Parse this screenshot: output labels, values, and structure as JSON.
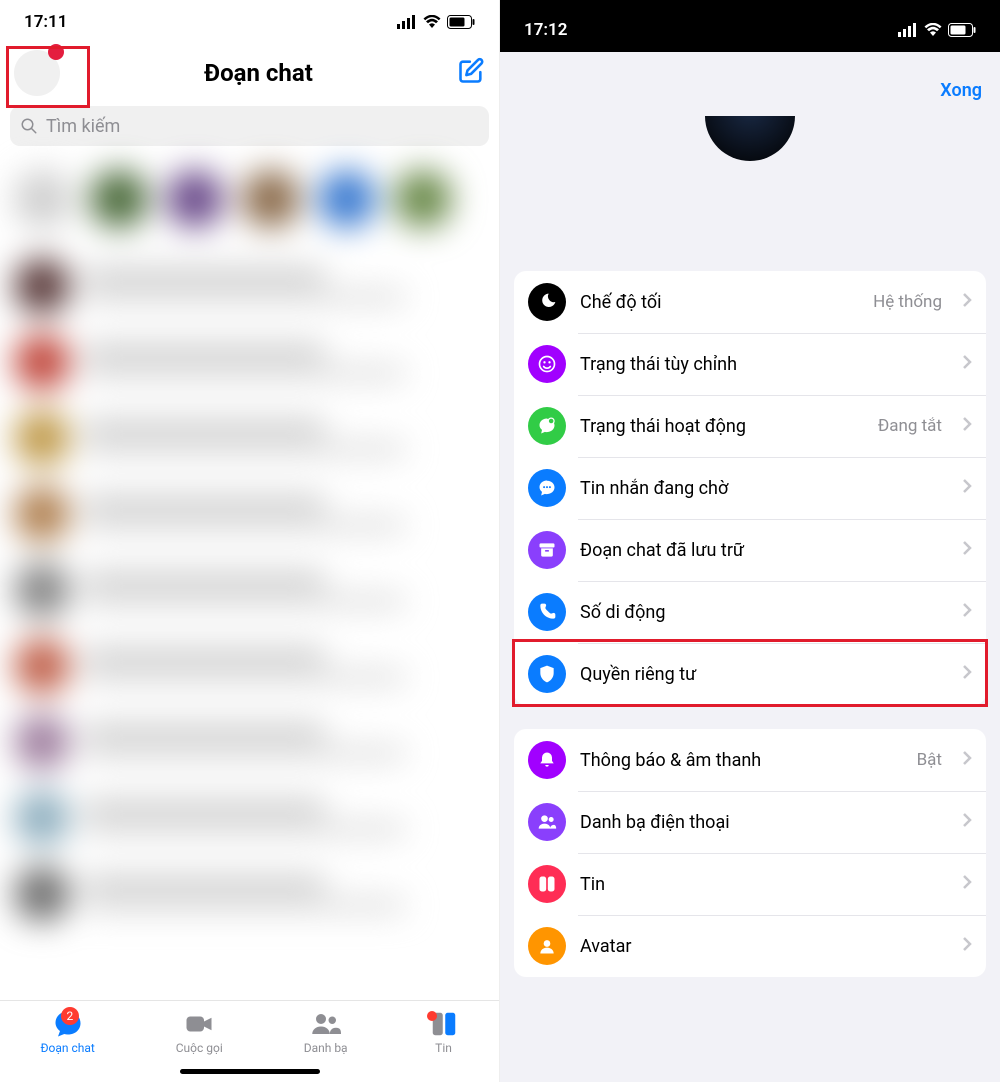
{
  "left": {
    "status": {
      "time": "17:11"
    },
    "header": {
      "title": "Đoạn chat"
    },
    "search": {
      "placeholder": "Tìm kiếm"
    },
    "tabs": {
      "chats": {
        "label": "Đoạn chat",
        "badge": "2"
      },
      "calls": {
        "label": "Cuộc gọi"
      },
      "contacts": {
        "label": "Danh bạ"
      },
      "stories": {
        "label": "Tin"
      }
    }
  },
  "right": {
    "status": {
      "time": "17:12"
    },
    "done": "Xong",
    "group1": [
      {
        "icon": "moon",
        "color": "#000000",
        "label": "Chế độ tối",
        "value": "Hệ thống"
      },
      {
        "icon": "smile",
        "color": "#a100ff",
        "label": "Trạng thái tùy chỉnh",
        "value": ""
      },
      {
        "icon": "bubble-dot",
        "color": "#31cc46",
        "label": "Trạng thái hoạt động",
        "value": "Đang tắt"
      },
      {
        "icon": "chat",
        "color": "#0a7cff",
        "label": "Tin nhắn đang chờ",
        "value": ""
      },
      {
        "icon": "archive",
        "color": "#8a3ffc",
        "label": "Đoạn chat đã lưu trữ",
        "value": ""
      },
      {
        "icon": "phone",
        "color": "#0a7cff",
        "label": "Số di động",
        "value": ""
      },
      {
        "icon": "shield",
        "color": "#0a7cff",
        "label": "Quyền riêng tư",
        "value": ""
      }
    ],
    "group2": [
      {
        "icon": "bell",
        "color": "#a100ff",
        "label": "Thông báo & âm thanh",
        "value": "Bật"
      },
      {
        "icon": "people",
        "color": "#8a3ffc",
        "label": "Danh bạ điện thoại",
        "value": ""
      },
      {
        "icon": "story",
        "color": "#ff2d55",
        "label": "Tin",
        "value": ""
      },
      {
        "icon": "avatar",
        "color": "#ff9500",
        "label": "Avatar",
        "value": ""
      }
    ]
  },
  "colors": {
    "accent": "#0a7cff",
    "highlight": "#e11b2c"
  }
}
